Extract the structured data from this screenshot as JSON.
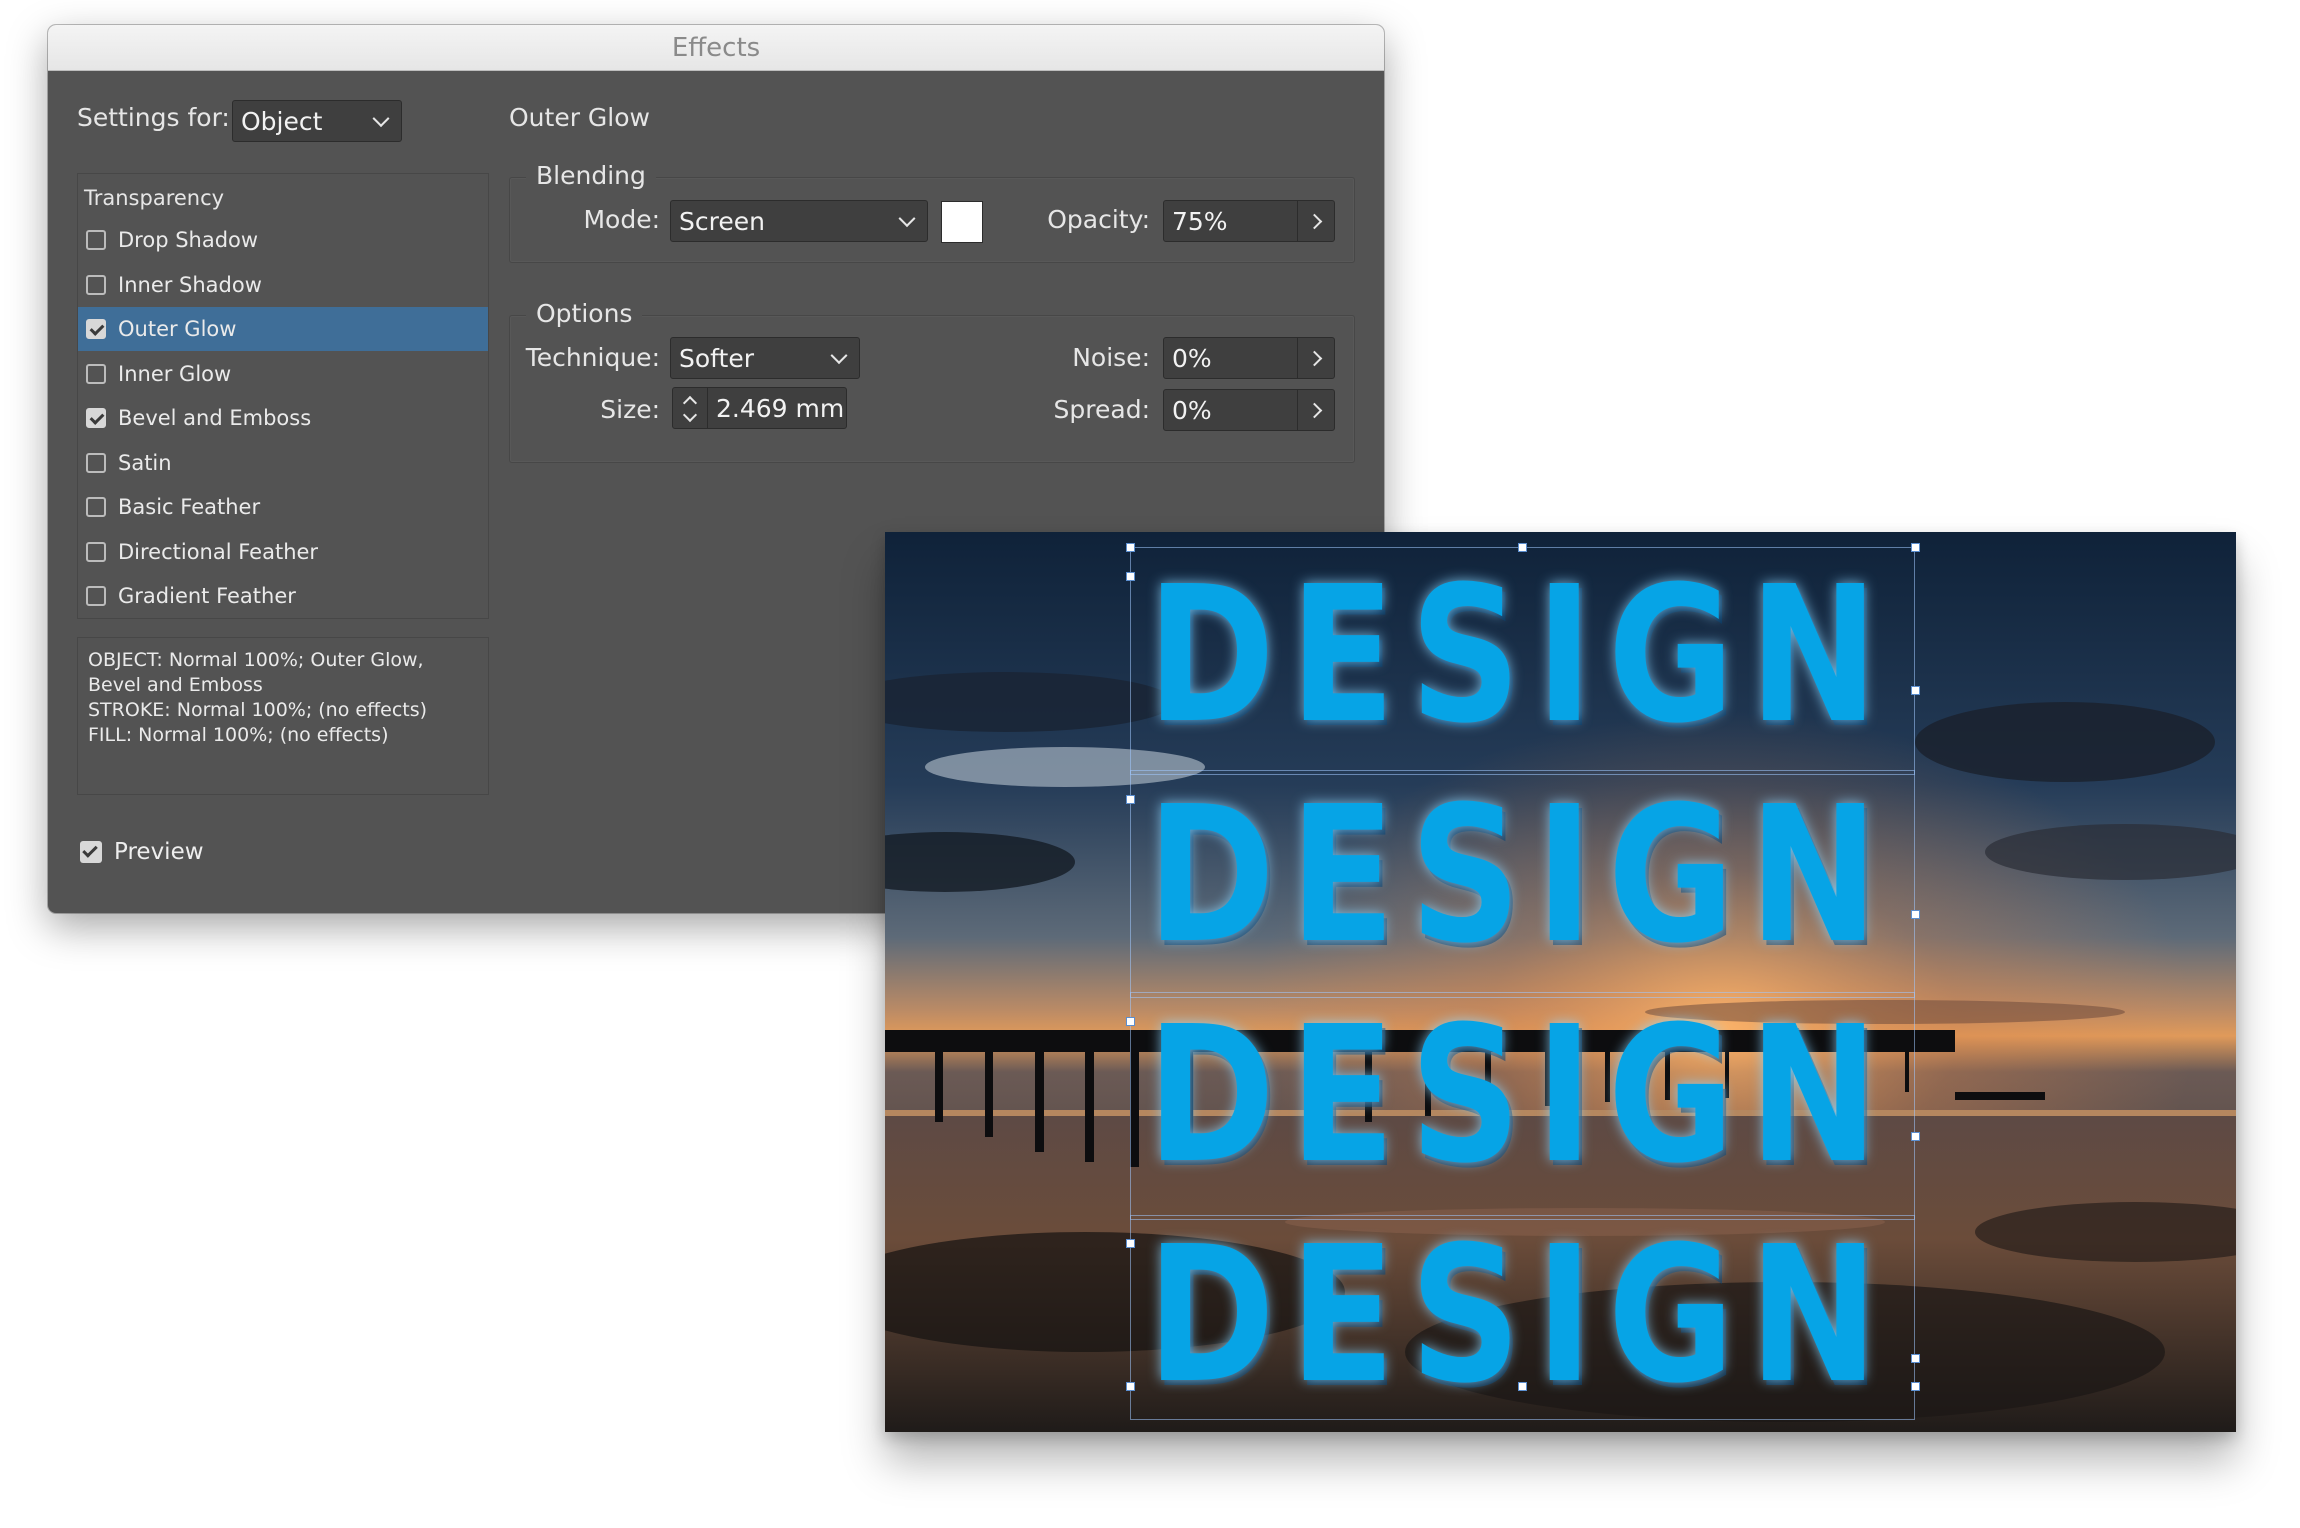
{
  "dialog": {
    "title": "Effects",
    "settings_for_label": "Settings for:",
    "settings_for_value": "Object",
    "panel_title": "Outer Glow",
    "blending": {
      "group_label": "Blending",
      "mode_label": "Mode:",
      "mode_value": "Screen",
      "swatch_color": "#ffffff",
      "opacity_label": "Opacity:",
      "opacity_value": "75%"
    },
    "options": {
      "group_label": "Options",
      "technique_label": "Technique:",
      "technique_value": "Softer",
      "noise_label": "Noise:",
      "noise_value": "0%",
      "size_label": "Size:",
      "size_value": "2.469 mm",
      "spread_label": "Spread:",
      "spread_value": "0%"
    },
    "list": {
      "header": "Transparency",
      "items": [
        {
          "label": "Drop Shadow",
          "checked": false,
          "selected": false
        },
        {
          "label": "Inner Shadow",
          "checked": false,
          "selected": false
        },
        {
          "label": "Outer Glow",
          "checked": true,
          "selected": true
        },
        {
          "label": "Inner Glow",
          "checked": false,
          "selected": false
        },
        {
          "label": "Bevel and Emboss",
          "checked": true,
          "selected": false
        },
        {
          "label": "Satin",
          "checked": false,
          "selected": false
        },
        {
          "label": "Basic Feather",
          "checked": false,
          "selected": false
        },
        {
          "label": "Directional Feather",
          "checked": false,
          "selected": false
        },
        {
          "label": "Gradient Feather",
          "checked": false,
          "selected": false
        }
      ]
    },
    "summary_lines": [
      "OBJECT: Normal 100%; Outer Glow,",
      "Bevel and Emboss",
      "STROKE: Normal 100%; (no effects)",
      "FILL: Normal 100%; (no effects)"
    ],
    "preview_label": "Preview",
    "preview_checked": true
  },
  "canvas": {
    "words": [
      "DESIGN",
      "DESIGN",
      "DESIGN",
      "DESIGN"
    ],
    "text_color": "#06a4e6"
  }
}
